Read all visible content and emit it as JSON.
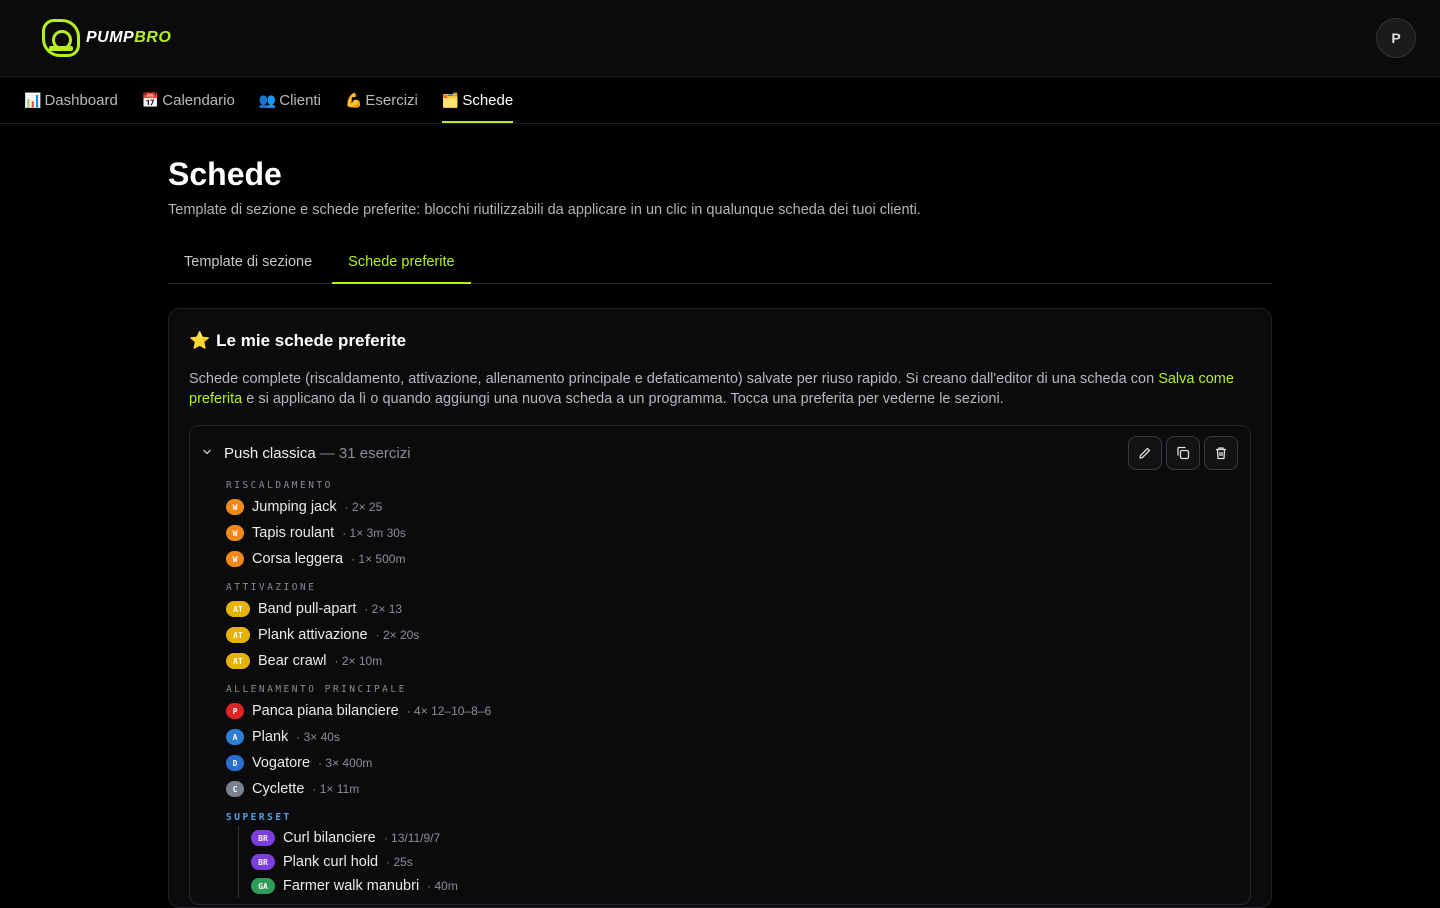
{
  "brand": {
    "name_main": "PUMP",
    "name_accent": "BRO"
  },
  "user": {
    "avatar_initial": "P"
  },
  "nav": [
    {
      "icon": "📊",
      "label": "Dashboard"
    },
    {
      "icon": "📅",
      "label": "Calendario"
    },
    {
      "icon": "👥",
      "label": "Clienti"
    },
    {
      "icon": "💪",
      "label": "Esercizi"
    },
    {
      "icon": "🗂️",
      "label": "Schede",
      "active": true
    }
  ],
  "page": {
    "title": "Schede",
    "subtitle": "Template di sezione e schede preferite: blocchi riutilizzabili da applicare in un clic in qualunque scheda dei tuoi clienti."
  },
  "tabs": [
    {
      "label": "Template di sezione"
    },
    {
      "label": "Schede preferite",
      "active": true
    }
  ],
  "panel": {
    "icon": "⭐",
    "title": "Le mie schede preferite",
    "desc_part1": "Schede complete (riscaldamento, attivazione, allenamento principale e defaticamento) salvate per riuso rapido. Si creano dall'editor di una scheda con ",
    "desc_highlight": "Salva come preferita",
    "desc_part2": " e si applicano da lì o quando aggiungi una nuova scheda a un programma. Tocca una preferita per vederne le sezioni."
  },
  "card": {
    "name": "Push classica",
    "count": "— 31 esercizi",
    "sections": [
      {
        "label": "RISCALDAMENTO",
        "exercises": [
          {
            "badge": "W",
            "color": "orange",
            "name": "Jumping jack",
            "meta": "· 2× 25"
          },
          {
            "badge": "W",
            "color": "orange",
            "name": "Tapis roulant",
            "meta": "· 1× 3m 30s"
          },
          {
            "badge": "W",
            "color": "orange",
            "name": "Corsa leggera",
            "meta": "· 1× 500m"
          }
        ]
      },
      {
        "label": "ATTIVAZIONE",
        "exercises": [
          {
            "badge": "AT",
            "color": "yellow",
            "name": "Band pull-apart",
            "meta": "· 2× 13"
          },
          {
            "badge": "AT",
            "color": "yellow",
            "name": "Plank attivazione",
            "meta": "· 2× 20s"
          },
          {
            "badge": "AT",
            "color": "yellow",
            "name": "Bear crawl",
            "meta": "· 2× 10m"
          }
        ]
      },
      {
        "label": "ALLENAMENTO PRINCIPALE",
        "exercises": [
          {
            "badge": "P",
            "color": "red",
            "name": "Panca piana bilanciere",
            "meta": "· 4× 12–10–8–6"
          },
          {
            "badge": "A",
            "color": "blue",
            "name": "Plank",
            "meta": "· 3× 40s"
          },
          {
            "badge": "D",
            "color": "navy",
            "name": "Vogatore",
            "meta": "· 3× 400m"
          },
          {
            "badge": "C",
            "color": "grey",
            "name": "Cyclette",
            "meta": "· 1× 11m"
          }
        ]
      }
    ],
    "superset": {
      "label": "SUPERSET",
      "exercises": [
        {
          "badge": "BR",
          "color": "purple",
          "name": "Curl bilanciere",
          "meta": "· 13/11/9/7"
        },
        {
          "badge": "BR",
          "color": "purple",
          "name": "Plank curl hold",
          "meta": "· 25s"
        },
        {
          "badge": "GA",
          "color": "green",
          "name": "Farmer walk manubri",
          "meta": "· 40m"
        }
      ]
    }
  },
  "colors": {
    "accent": "#b4f01e",
    "background": "#000000"
  }
}
